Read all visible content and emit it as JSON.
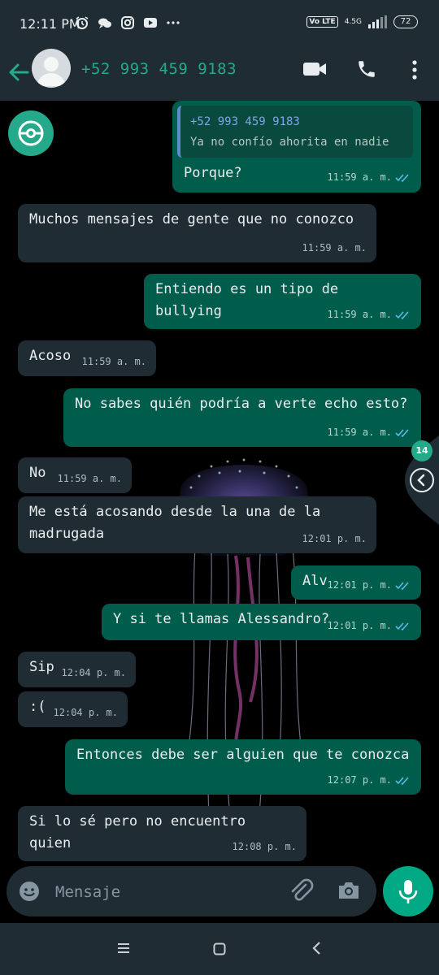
{
  "status_bar": {
    "time": "12:11 PM",
    "volte": "Vo LTE",
    "network": "4.5G",
    "battery": "72"
  },
  "header": {
    "contact_name": "+52 993 459 9183",
    "icons": [
      "back-arrow-icon",
      "avatar",
      "video-call-icon",
      "phone-icon",
      "more-vert-icon"
    ]
  },
  "chat": {
    "quoted": {
      "name": "+52 993 459 9183",
      "text": "Ya no confío ahorita en nadie"
    },
    "messages": [
      {
        "dir": "out",
        "text": "Porque?",
        "time": "11:59 a. m."
      },
      {
        "dir": "in",
        "text": "Muchos mensajes de gente que no conozco",
        "time": "11:59 a. m."
      },
      {
        "dir": "out",
        "text": "Entiendo es un tipo de bullying",
        "time": "11:59 a. m."
      },
      {
        "dir": "in",
        "text": "Acoso",
        "time": "11:59 a. m."
      },
      {
        "dir": "out",
        "text": "No sabes quién podría a verte echo esto?",
        "time": "11:59 a. m."
      },
      {
        "dir": "in",
        "text": "No",
        "time": "11:59 a. m."
      },
      {
        "dir": "in",
        "text": "Me está acosando desde la una de la madrugada",
        "time": "12:01 p. m."
      },
      {
        "dir": "out",
        "text": "Alv",
        "time": "12:01 p. m."
      },
      {
        "dir": "out",
        "text": "Y si te llamas Alessandro?",
        "time": "12:01 p. m."
      },
      {
        "dir": "in",
        "text": "Sip",
        "time": "12:04 p. m."
      },
      {
        "dir": "in",
        "text": ":(",
        "time": "12:04 p. m."
      },
      {
        "dir": "out",
        "text": "Entonces debe ser alguien que te conozca",
        "time": "12:07 p. m."
      },
      {
        "dir": "in",
        "text": "Si lo sé pero no encuentro quien",
        "time": "12:08 p. m."
      }
    ],
    "unread_count": "14"
  },
  "input": {
    "placeholder": "Mensaje"
  },
  "colors": {
    "incoming": "#202c33",
    "outgoing": "#005c4b",
    "accent": "#00a884",
    "header": "#1f2c34",
    "read_ticks": "#53bdeb"
  }
}
